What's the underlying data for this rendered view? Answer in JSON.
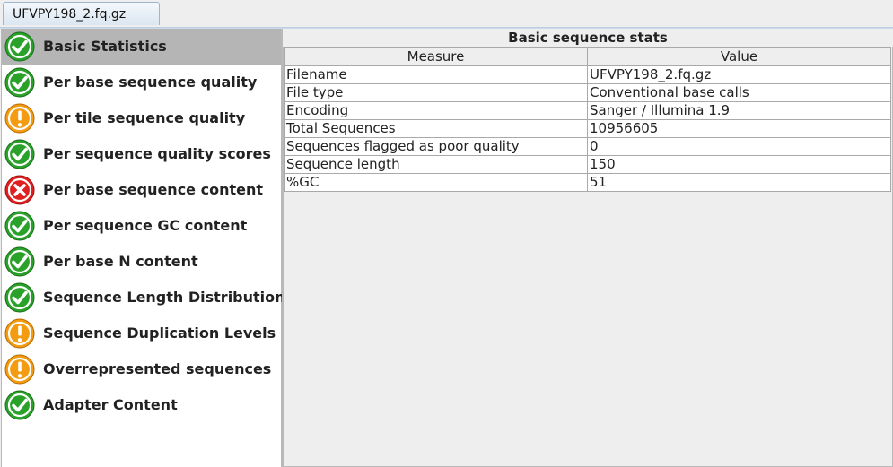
{
  "tab": {
    "label": "UFVPY198_2.fq.gz"
  },
  "modules": [
    {
      "label": "Basic Statistics",
      "status": "pass",
      "selected": true
    },
    {
      "label": "Per base sequence quality",
      "status": "pass"
    },
    {
      "label": "Per tile sequence quality",
      "status": "warn"
    },
    {
      "label": "Per sequence quality scores",
      "status": "pass"
    },
    {
      "label": "Per base sequence content",
      "status": "fail"
    },
    {
      "label": "Per sequence GC content",
      "status": "pass"
    },
    {
      "label": "Per base N content",
      "status": "pass"
    },
    {
      "label": "Sequence Length Distribution",
      "status": "pass"
    },
    {
      "label": "Sequence Duplication Levels",
      "status": "warn"
    },
    {
      "label": "Overrepresented sequences",
      "status": "warn"
    },
    {
      "label": "Adapter Content",
      "status": "pass"
    }
  ],
  "results": {
    "title": "Basic sequence stats",
    "columns": [
      "Measure",
      "Value"
    ],
    "rows": [
      [
        "Filename",
        "UFVPY198_2.fq.gz"
      ],
      [
        "File type",
        "Conventional base calls"
      ],
      [
        "Encoding",
        "Sanger / Illumina 1.9"
      ],
      [
        "Total Sequences",
        "10956605"
      ],
      [
        "Sequences flagged as poor quality",
        "0"
      ],
      [
        "Sequence length",
        "150"
      ],
      [
        "%GC",
        "51"
      ]
    ]
  },
  "colors": {
    "pass": "#2aa22a",
    "warn": "#f39c12",
    "fail": "#e02020",
    "selected": "#b5b5b5"
  }
}
